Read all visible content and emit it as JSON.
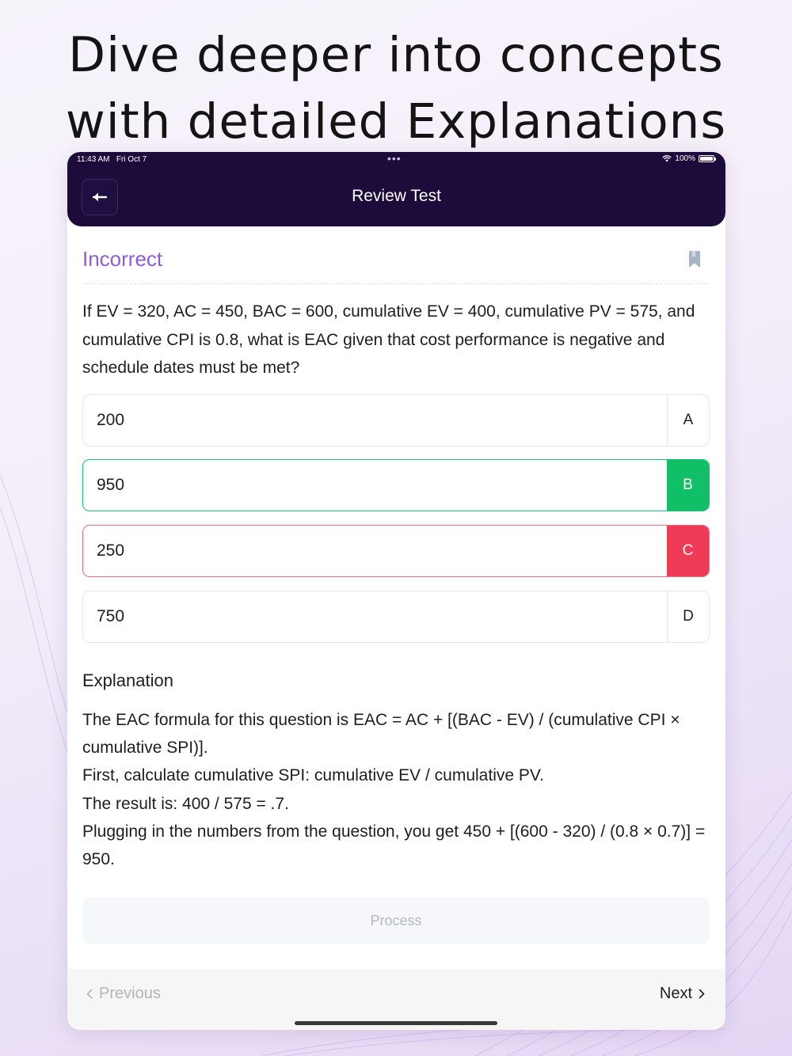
{
  "headline": {
    "line1": "Dive deeper into concepts",
    "line2": "with detailed Explanations"
  },
  "status_bar": {
    "time": "11:43 AM",
    "date": "Fri Oct 7",
    "dots": "•••",
    "battery": "100%",
    "wifi_icon": "wifi-icon",
    "battery_icon": "battery-icon"
  },
  "nav": {
    "back_icon": "arrow-left-icon",
    "title": "Review Test"
  },
  "result": {
    "label": "Incorrect",
    "label_color": "#8f5cd6",
    "bookmark_icon": "bookmark-icon"
  },
  "question": {
    "text": "If EV = 320, AC = 450, BAC = 600, cumulative EV = 400, cumulative PV = 575, and cumulative CPI is 0.8, what is EAC given that cost performance is negative and schedule dates must be met?"
  },
  "options": [
    {
      "letter": "A",
      "text": "200",
      "state": "neutral"
    },
    {
      "letter": "B",
      "text": "950",
      "state": "correct"
    },
    {
      "letter": "C",
      "text": "250",
      "state": "selected-wrong"
    },
    {
      "letter": "D",
      "text": "750",
      "state": "neutral"
    }
  ],
  "colors": {
    "correct": "#10bf66",
    "wrong": "#ef3b57",
    "header_bg": "#1c0b3b"
  },
  "explanation": {
    "title": "Explanation",
    "lines": [
      "The EAC formula for this question is EAC = AC + [(BAC - EV) / (cumulative CPI × cumulative SPI)].",
      "First, calculate cumulative SPI: cumulative EV / cumulative PV.",
      "The result is: 400 / 575 = .7.",
      "Plugging in the numbers from the question, you get 450 + [(600 - 320) / (0.8 × 0.7)] = 950."
    ]
  },
  "process_button": {
    "label": "Process"
  },
  "footer": {
    "previous_label": "Previous",
    "next_label": "Next",
    "previous_icon": "chevron-left-icon",
    "next_icon": "chevron-right-icon"
  }
}
